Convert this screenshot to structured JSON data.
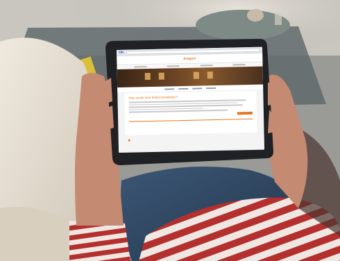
{
  "scene": {
    "description_hidden": "",
    "colors": {
      "sofa": "#e4dccd",
      "tablet_frame": "#1f2124",
      "stripe_red": "#b3302e",
      "stripe_white": "#efe7e2",
      "jeans": "#2f4660",
      "skin": "#c98f78",
      "accent": "#e87722"
    }
  },
  "tablet": {
    "site_logo": "dragon",
    "browser_logo": "OK",
    "content_title": "Was kostet eine Elektroinstallation?"
  }
}
